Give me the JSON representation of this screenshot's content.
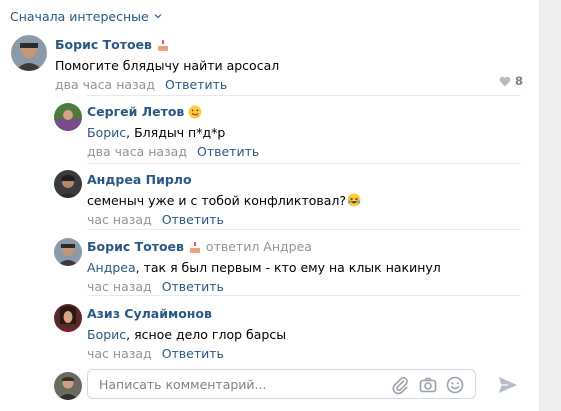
{
  "sort": {
    "label": "Сначала интересные"
  },
  "comments": [
    {
      "author": "Борис Тотоев",
      "has_emoji": true,
      "replied_prefix": "",
      "replied_to": "",
      "mention": "",
      "text": "Помогите блядычу найти арсосал",
      "time": "два часа назад",
      "reply_label": "Ответить",
      "likes": "8"
    },
    {
      "author": "Сергей Летов",
      "has_emoji": true,
      "replied_prefix": "",
      "replied_to": "",
      "mention": "Борис",
      "text": ", Блядыч п*д*р",
      "time": "два часа назад",
      "reply_label": "Ответить"
    },
    {
      "author": "Андреа Пирло",
      "has_emoji": false,
      "replied_prefix": "",
      "replied_to": "",
      "mention": "",
      "text": "семеныч уже и с тобой конфликтовал?",
      "time": "час назад",
      "reply_label": "Ответить"
    },
    {
      "author": "Борис Тотоев",
      "has_emoji": true,
      "replied_prefix": "ответил",
      "replied_to": "Андреа",
      "mention": "Андреа",
      "text": ", так я был первым - кто ему на клык накинул",
      "time": "час назад",
      "reply_label": "Ответить"
    },
    {
      "author": "Азиз Сулаймонов",
      "has_emoji": false,
      "replied_prefix": "",
      "replied_to": "",
      "mention": "Борис",
      "text": ", ясное дело глор барсы",
      "time": "час назад",
      "reply_label": "Ответить"
    }
  ],
  "composer": {
    "placeholder": "Написать комментарий..."
  },
  "colors": {
    "link": "#2a5885",
    "muted": "#939393",
    "border": "#e7e8ec"
  }
}
